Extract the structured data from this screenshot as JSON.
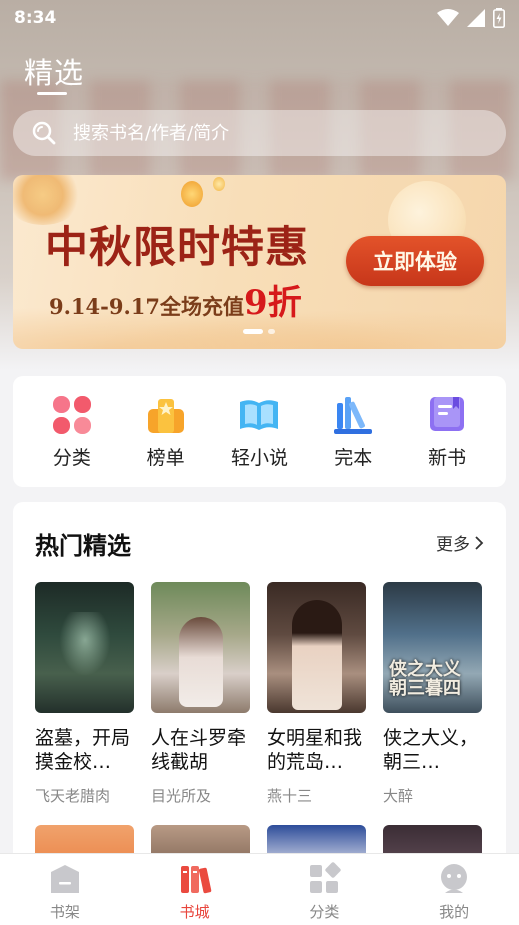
{
  "status_bar": {
    "time": "8:34"
  },
  "header": {
    "title": "精选"
  },
  "search": {
    "placeholder": "搜索书名/作者/简介"
  },
  "banner": {
    "title": "中秋限时特惠",
    "sub_prefix": "9.14-9.17全场充值",
    "sub_discount_number": "9",
    "sub_discount_unit": "折",
    "button": "立即体验",
    "slide_count": 2,
    "active_slide": 1
  },
  "categories": [
    {
      "label": "分类",
      "icon": "grid-petals-icon",
      "color": "#f05a5a"
    },
    {
      "label": "榜单",
      "icon": "trophy-star-icon",
      "color": "#f5a22a"
    },
    {
      "label": "轻小说",
      "icon": "open-book-icon",
      "color": "#3aa9f0"
    },
    {
      "label": "完本",
      "icon": "books-stack-icon",
      "color": "#3a82f0"
    },
    {
      "label": "新书",
      "icon": "new-book-icon",
      "color": "#8a6cf0"
    }
  ],
  "hot": {
    "title": "热门精选",
    "more": "更多",
    "books": [
      {
        "title": "盗墓，开局摸金校…",
        "author": "飞天老腊肉"
      },
      {
        "title": "人在斗罗牵线截胡",
        "author": "目光所及"
      },
      {
        "title": "女明星和我的荒岛…",
        "author": "燕十三"
      },
      {
        "title": "侠之大义，朝三…",
        "author": "大醉",
        "cover_text": "侠之大义 朝三暮四"
      }
    ]
  },
  "tabbar": {
    "tabs": [
      {
        "label": "书架",
        "icon": "bookshelf-icon",
        "active": false
      },
      {
        "label": "书城",
        "icon": "bookstore-icon",
        "active": true
      },
      {
        "label": "分类",
        "icon": "category-icon",
        "active": false
      },
      {
        "label": "我的",
        "icon": "profile-icon",
        "active": false
      }
    ]
  },
  "colors": {
    "accent": "#e8453c",
    "banner_button": "#d3421f",
    "banner_title": "#9c2316"
  }
}
